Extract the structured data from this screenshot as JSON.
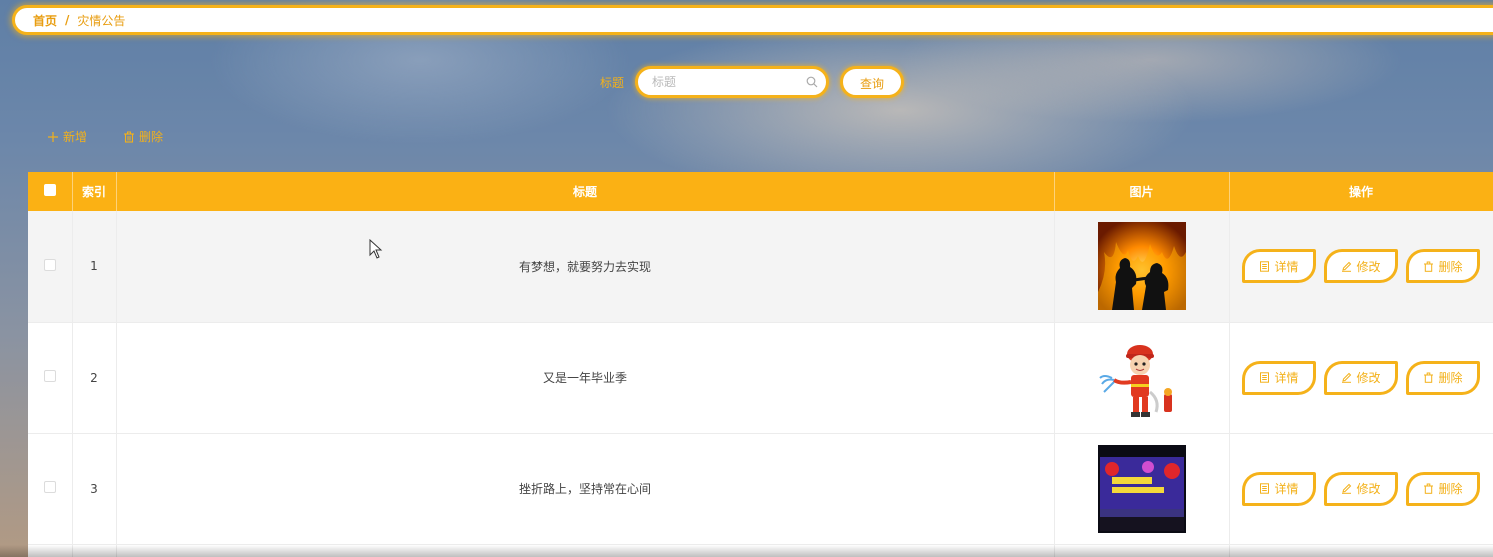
{
  "breadcrumb": {
    "home": "首页",
    "separator": "/",
    "current": "灾情公告"
  },
  "search": {
    "label": "标题",
    "placeholder": "标题",
    "value": "",
    "button": "查询"
  },
  "toolbar": {
    "add": "新增",
    "delete": "删除"
  },
  "colors": {
    "accent": "#fbb114",
    "accent_text": "#f3b11a"
  },
  "table": {
    "columns": {
      "index": "索引",
      "title": "标题",
      "image": "图片",
      "actions": "操作"
    },
    "rows": [
      {
        "index": "1",
        "title": "有梦想，就要努力去实现",
        "image": "firefighters-silhouette-fire"
      },
      {
        "index": "2",
        "title": "又是一年毕业季",
        "image": "cartoon-firefighter-hose"
      },
      {
        "index": "3",
        "title": "挫折路上，坚持常在心间",
        "image": "fire-safety-stage-banner"
      }
    ],
    "actions": {
      "detail": "详情",
      "edit": "修改",
      "delete": "删除"
    }
  }
}
